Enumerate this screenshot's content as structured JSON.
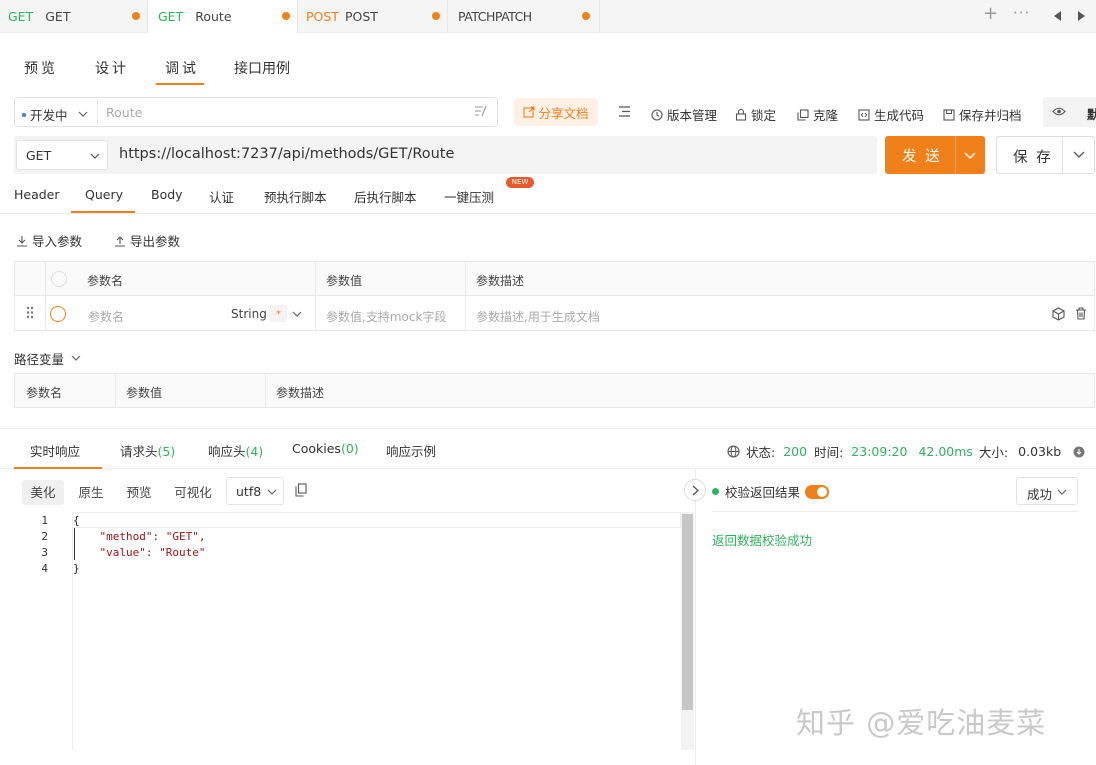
{
  "tabs": [
    {
      "method": "GET",
      "name": "GET",
      "method_color": "#2db55d"
    },
    {
      "method": "GET",
      "name": "Route",
      "method_color": "#2db55d"
    },
    {
      "method": "POST",
      "name": "POST",
      "method_color": "#f0811a"
    },
    {
      "method": "PATCH",
      "name": "PATCH",
      "method_color": "#444444"
    }
  ],
  "subnav": [
    "预览",
    "设计",
    "调试",
    "接口用例"
  ],
  "toolbar": {
    "env": "开发中",
    "route_placeholder": "Route",
    "share": "分享文档",
    "version": "版本管理",
    "lock": "锁定",
    "clone": "克隆",
    "gen_code": "生成代码",
    "save_archive": "保存并归档",
    "cut": "默"
  },
  "request": {
    "method": "GET",
    "url": "https://localhost:7237/api/methods/GET/Route",
    "send": "发 送",
    "save": "保 存"
  },
  "req_tabs": [
    "Header",
    "Query",
    "Body",
    "认证",
    "预执行脚本",
    "后执行脚本",
    "一键压测"
  ],
  "new_badge": "NEW",
  "params": {
    "import": "导入参数",
    "export": "导出参数",
    "headers": [
      "参数名",
      "参数值",
      "参数描述"
    ],
    "row": {
      "name_placeholder": "参数名",
      "type": "String",
      "required": "*",
      "value_placeholder": "参数值,支持mock字段",
      "desc_placeholder": "参数描述,用于生成文档"
    }
  },
  "path_vars": {
    "title": "路径变量",
    "headers": [
      "参数名",
      "参数值",
      "参数描述"
    ]
  },
  "response": {
    "tabs": [
      {
        "label": "实时响应"
      },
      {
        "label": "请求头",
        "count": "(5)"
      },
      {
        "label": "响应头",
        "count": "(4)"
      },
      {
        "label": "Cookies",
        "count": "(0)"
      },
      {
        "label": "响应示例"
      }
    ],
    "status_label": "状态:",
    "status": "200",
    "time_label": "时间:",
    "time": "23:09:20",
    "duration": "42.00ms",
    "size_label": "大小:",
    "size": "0.03kb",
    "format_buttons": [
      "美化",
      "原生",
      "预览",
      "可视化"
    ],
    "encoding": "utf8",
    "code_lines": [
      "{",
      "    \"method\": \"GET\",",
      "    \"value\": \"Route\"",
      "}"
    ],
    "validate_label": "校验返回结果",
    "result_select": "成功",
    "validate_msg": "返回数据校验成功"
  },
  "watermark": "知乎 @爱吃油麦菜",
  "colors": {
    "accent": "#f0811a",
    "success": "#2db55d"
  }
}
